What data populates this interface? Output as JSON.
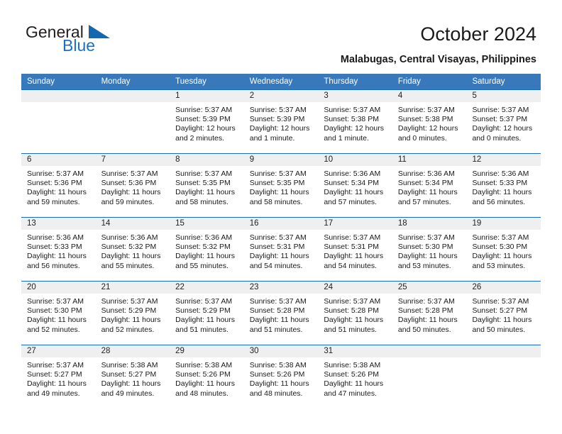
{
  "brand": {
    "name_top": "General",
    "name_bottom": "Blue",
    "color_dark": "#231f20",
    "color_blue": "#1d72bb"
  },
  "header": {
    "title": "October 2024",
    "location": "Malabugas, Central Visayas, Philippines"
  },
  "theme": {
    "header_row_bg": "#3879bb",
    "row_divider": "#1d6cb0",
    "daynum_band_bg": "#efefef",
    "text": "#1a1a1a"
  },
  "weekdays": [
    "Sunday",
    "Monday",
    "Tuesday",
    "Wednesday",
    "Thursday",
    "Friday",
    "Saturday"
  ],
  "labels": {
    "sunrise": "Sunrise:",
    "sunset": "Sunset:",
    "daylight": "Daylight:"
  },
  "weeks": [
    [
      {
        "day": "",
        "sunrise": "",
        "sunset": "",
        "daylight_line1": "",
        "daylight_line2": ""
      },
      {
        "day": "",
        "sunrise": "",
        "sunset": "",
        "daylight_line1": "",
        "daylight_line2": ""
      },
      {
        "day": "1",
        "sunrise": "Sunrise: 5:37 AM",
        "sunset": "Sunset: 5:39 PM",
        "daylight_line1": "Daylight: 12 hours",
        "daylight_line2": "and 2 minutes."
      },
      {
        "day": "2",
        "sunrise": "Sunrise: 5:37 AM",
        "sunset": "Sunset: 5:39 PM",
        "daylight_line1": "Daylight: 12 hours",
        "daylight_line2": "and 1 minute."
      },
      {
        "day": "3",
        "sunrise": "Sunrise: 5:37 AM",
        "sunset": "Sunset: 5:38 PM",
        "daylight_line1": "Daylight: 12 hours",
        "daylight_line2": "and 1 minute."
      },
      {
        "day": "4",
        "sunrise": "Sunrise: 5:37 AM",
        "sunset": "Sunset: 5:38 PM",
        "daylight_line1": "Daylight: 12 hours",
        "daylight_line2": "and 0 minutes."
      },
      {
        "day": "5",
        "sunrise": "Sunrise: 5:37 AM",
        "sunset": "Sunset: 5:37 PM",
        "daylight_line1": "Daylight: 12 hours",
        "daylight_line2": "and 0 minutes."
      }
    ],
    [
      {
        "day": "6",
        "sunrise": "Sunrise: 5:37 AM",
        "sunset": "Sunset: 5:36 PM",
        "daylight_line1": "Daylight: 11 hours",
        "daylight_line2": "and 59 minutes."
      },
      {
        "day": "7",
        "sunrise": "Sunrise: 5:37 AM",
        "sunset": "Sunset: 5:36 PM",
        "daylight_line1": "Daylight: 11 hours",
        "daylight_line2": "and 59 minutes."
      },
      {
        "day": "8",
        "sunrise": "Sunrise: 5:37 AM",
        "sunset": "Sunset: 5:35 PM",
        "daylight_line1": "Daylight: 11 hours",
        "daylight_line2": "and 58 minutes."
      },
      {
        "day": "9",
        "sunrise": "Sunrise: 5:37 AM",
        "sunset": "Sunset: 5:35 PM",
        "daylight_line1": "Daylight: 11 hours",
        "daylight_line2": "and 58 minutes."
      },
      {
        "day": "10",
        "sunrise": "Sunrise: 5:36 AM",
        "sunset": "Sunset: 5:34 PM",
        "daylight_line1": "Daylight: 11 hours",
        "daylight_line2": "and 57 minutes."
      },
      {
        "day": "11",
        "sunrise": "Sunrise: 5:36 AM",
        "sunset": "Sunset: 5:34 PM",
        "daylight_line1": "Daylight: 11 hours",
        "daylight_line2": "and 57 minutes."
      },
      {
        "day": "12",
        "sunrise": "Sunrise: 5:36 AM",
        "sunset": "Sunset: 5:33 PM",
        "daylight_line1": "Daylight: 11 hours",
        "daylight_line2": "and 56 minutes."
      }
    ],
    [
      {
        "day": "13",
        "sunrise": "Sunrise: 5:36 AM",
        "sunset": "Sunset: 5:33 PM",
        "daylight_line1": "Daylight: 11 hours",
        "daylight_line2": "and 56 minutes."
      },
      {
        "day": "14",
        "sunrise": "Sunrise: 5:36 AM",
        "sunset": "Sunset: 5:32 PM",
        "daylight_line1": "Daylight: 11 hours",
        "daylight_line2": "and 55 minutes."
      },
      {
        "day": "15",
        "sunrise": "Sunrise: 5:36 AM",
        "sunset": "Sunset: 5:32 PM",
        "daylight_line1": "Daylight: 11 hours",
        "daylight_line2": "and 55 minutes."
      },
      {
        "day": "16",
        "sunrise": "Sunrise: 5:37 AM",
        "sunset": "Sunset: 5:31 PM",
        "daylight_line1": "Daylight: 11 hours",
        "daylight_line2": "and 54 minutes."
      },
      {
        "day": "17",
        "sunrise": "Sunrise: 5:37 AM",
        "sunset": "Sunset: 5:31 PM",
        "daylight_line1": "Daylight: 11 hours",
        "daylight_line2": "and 54 minutes."
      },
      {
        "day": "18",
        "sunrise": "Sunrise: 5:37 AM",
        "sunset": "Sunset: 5:30 PM",
        "daylight_line1": "Daylight: 11 hours",
        "daylight_line2": "and 53 minutes."
      },
      {
        "day": "19",
        "sunrise": "Sunrise: 5:37 AM",
        "sunset": "Sunset: 5:30 PM",
        "daylight_line1": "Daylight: 11 hours",
        "daylight_line2": "and 53 minutes."
      }
    ],
    [
      {
        "day": "20",
        "sunrise": "Sunrise: 5:37 AM",
        "sunset": "Sunset: 5:30 PM",
        "daylight_line1": "Daylight: 11 hours",
        "daylight_line2": "and 52 minutes."
      },
      {
        "day": "21",
        "sunrise": "Sunrise: 5:37 AM",
        "sunset": "Sunset: 5:29 PM",
        "daylight_line1": "Daylight: 11 hours",
        "daylight_line2": "and 52 minutes."
      },
      {
        "day": "22",
        "sunrise": "Sunrise: 5:37 AM",
        "sunset": "Sunset: 5:29 PM",
        "daylight_line1": "Daylight: 11 hours",
        "daylight_line2": "and 51 minutes."
      },
      {
        "day": "23",
        "sunrise": "Sunrise: 5:37 AM",
        "sunset": "Sunset: 5:28 PM",
        "daylight_line1": "Daylight: 11 hours",
        "daylight_line2": "and 51 minutes."
      },
      {
        "day": "24",
        "sunrise": "Sunrise: 5:37 AM",
        "sunset": "Sunset: 5:28 PM",
        "daylight_line1": "Daylight: 11 hours",
        "daylight_line2": "and 51 minutes."
      },
      {
        "day": "25",
        "sunrise": "Sunrise: 5:37 AM",
        "sunset": "Sunset: 5:28 PM",
        "daylight_line1": "Daylight: 11 hours",
        "daylight_line2": "and 50 minutes."
      },
      {
        "day": "26",
        "sunrise": "Sunrise: 5:37 AM",
        "sunset": "Sunset: 5:27 PM",
        "daylight_line1": "Daylight: 11 hours",
        "daylight_line2": "and 50 minutes."
      }
    ],
    [
      {
        "day": "27",
        "sunrise": "Sunrise: 5:37 AM",
        "sunset": "Sunset: 5:27 PM",
        "daylight_line1": "Daylight: 11 hours",
        "daylight_line2": "and 49 minutes."
      },
      {
        "day": "28",
        "sunrise": "Sunrise: 5:38 AM",
        "sunset": "Sunset: 5:27 PM",
        "daylight_line1": "Daylight: 11 hours",
        "daylight_line2": "and 49 minutes."
      },
      {
        "day": "29",
        "sunrise": "Sunrise: 5:38 AM",
        "sunset": "Sunset: 5:26 PM",
        "daylight_line1": "Daylight: 11 hours",
        "daylight_line2": "and 48 minutes."
      },
      {
        "day": "30",
        "sunrise": "Sunrise: 5:38 AM",
        "sunset": "Sunset: 5:26 PM",
        "daylight_line1": "Daylight: 11 hours",
        "daylight_line2": "and 48 minutes."
      },
      {
        "day": "31",
        "sunrise": "Sunrise: 5:38 AM",
        "sunset": "Sunset: 5:26 PM",
        "daylight_line1": "Daylight: 11 hours",
        "daylight_line2": "and 47 minutes."
      },
      {
        "day": "",
        "sunrise": "",
        "sunset": "",
        "daylight_line1": "",
        "daylight_line2": ""
      },
      {
        "day": "",
        "sunrise": "",
        "sunset": "",
        "daylight_line1": "",
        "daylight_line2": ""
      }
    ]
  ]
}
